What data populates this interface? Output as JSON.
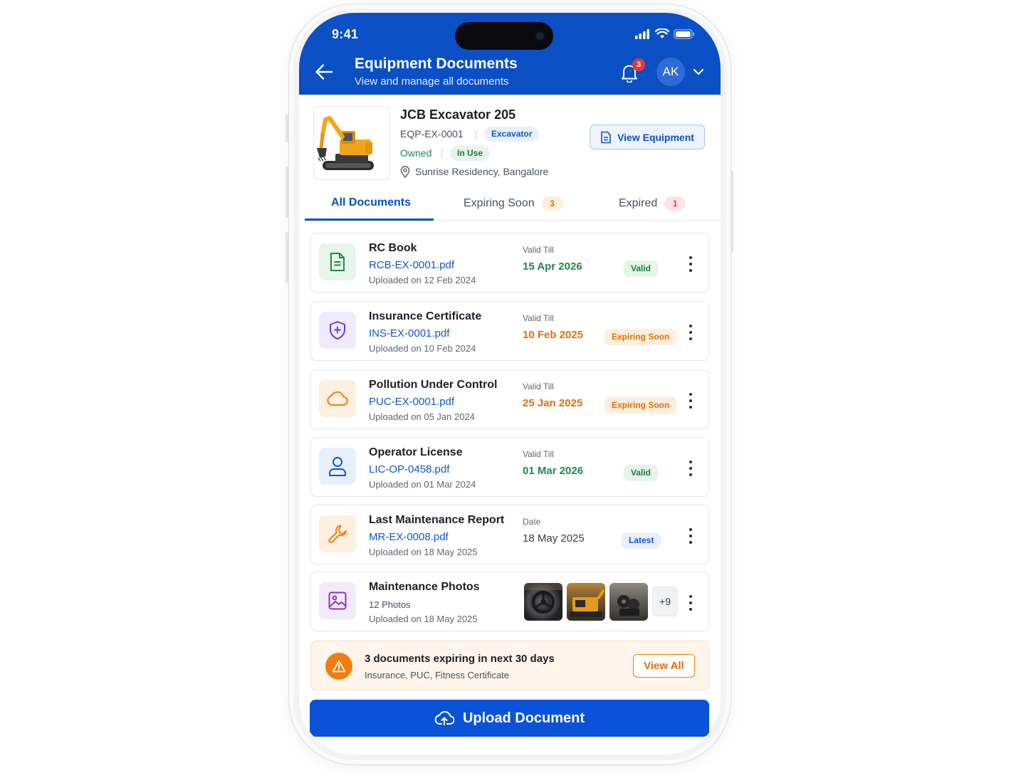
{
  "status_bar": {
    "time": "9:41"
  },
  "header": {
    "title": "Equipment Documents",
    "subtitle": "View and manage all documents",
    "notification_count": "3",
    "avatar_initials": "AK"
  },
  "equipment": {
    "name": "JCB Excavator 205",
    "id": "EQP-EX-0001",
    "type_tag": "Excavator",
    "ownership": "Owned",
    "status_tag": "In Use",
    "location": "Sunrise Residency, Bangalore",
    "view_button": "View Equipment"
  },
  "tabs": [
    {
      "label": "All Documents",
      "count": ""
    },
    {
      "label": "Expiring Soon",
      "count": "3"
    },
    {
      "label": "Expired",
      "count": "1"
    }
  ],
  "documents": [
    {
      "title": "RC Book",
      "file": "RCB-EX-0001.pdf",
      "uploaded": "Uploaded on 12 Feb 2024",
      "date_label": "Valid Till",
      "date": "15 Apr 2026",
      "badge": "Valid",
      "icon": "document-icon"
    },
    {
      "title": "Insurance Certificate",
      "file": "INS-EX-0001.pdf",
      "uploaded": "Uploaded on 10 Feb 2024",
      "date_label": "Valid Till",
      "date": "10 Feb 2025",
      "badge": "Expiring Soon",
      "icon": "shield-plus-icon"
    },
    {
      "title": "Pollution Under Control",
      "file": "PUC-EX-0001.pdf",
      "uploaded": "Uploaded on 05 Jan 2024",
      "date_label": "Valid Till",
      "date": "25 Jan 2025",
      "badge": "Expiring Soon",
      "icon": "cloud-icon"
    },
    {
      "title": "Operator License",
      "file": "LIC-OP-0458.pdf",
      "uploaded": "Uploaded on 01 Mar 2024",
      "date_label": "Valid Till",
      "date": "01 Mar 2026",
      "badge": "Valid",
      "icon": "user-icon"
    },
    {
      "title": "Last Maintenance Report",
      "file": "MR-EX-0008.pdf",
      "uploaded": "Uploaded on 18 May 2025",
      "date_label": "Date",
      "date": "18 May 2025",
      "badge": "Latest",
      "icon": "wrench-icon"
    },
    {
      "title": "Maintenance Photos",
      "file": "12 Photos",
      "uploaded": "Uploaded on 18 May 2025",
      "more_photos": "+9",
      "icon": "image-icon"
    }
  ],
  "alert": {
    "title": "3 documents expiring in next 30 days",
    "subtitle": "Insurance, PUC, Fitness Certificate",
    "button": "View All"
  },
  "upload_button": "Upload Document",
  "colors": {
    "primary": "#0a4fc4",
    "valid": "#1e8a4c",
    "expiring": "#e0700a",
    "expired": "#e53935"
  }
}
